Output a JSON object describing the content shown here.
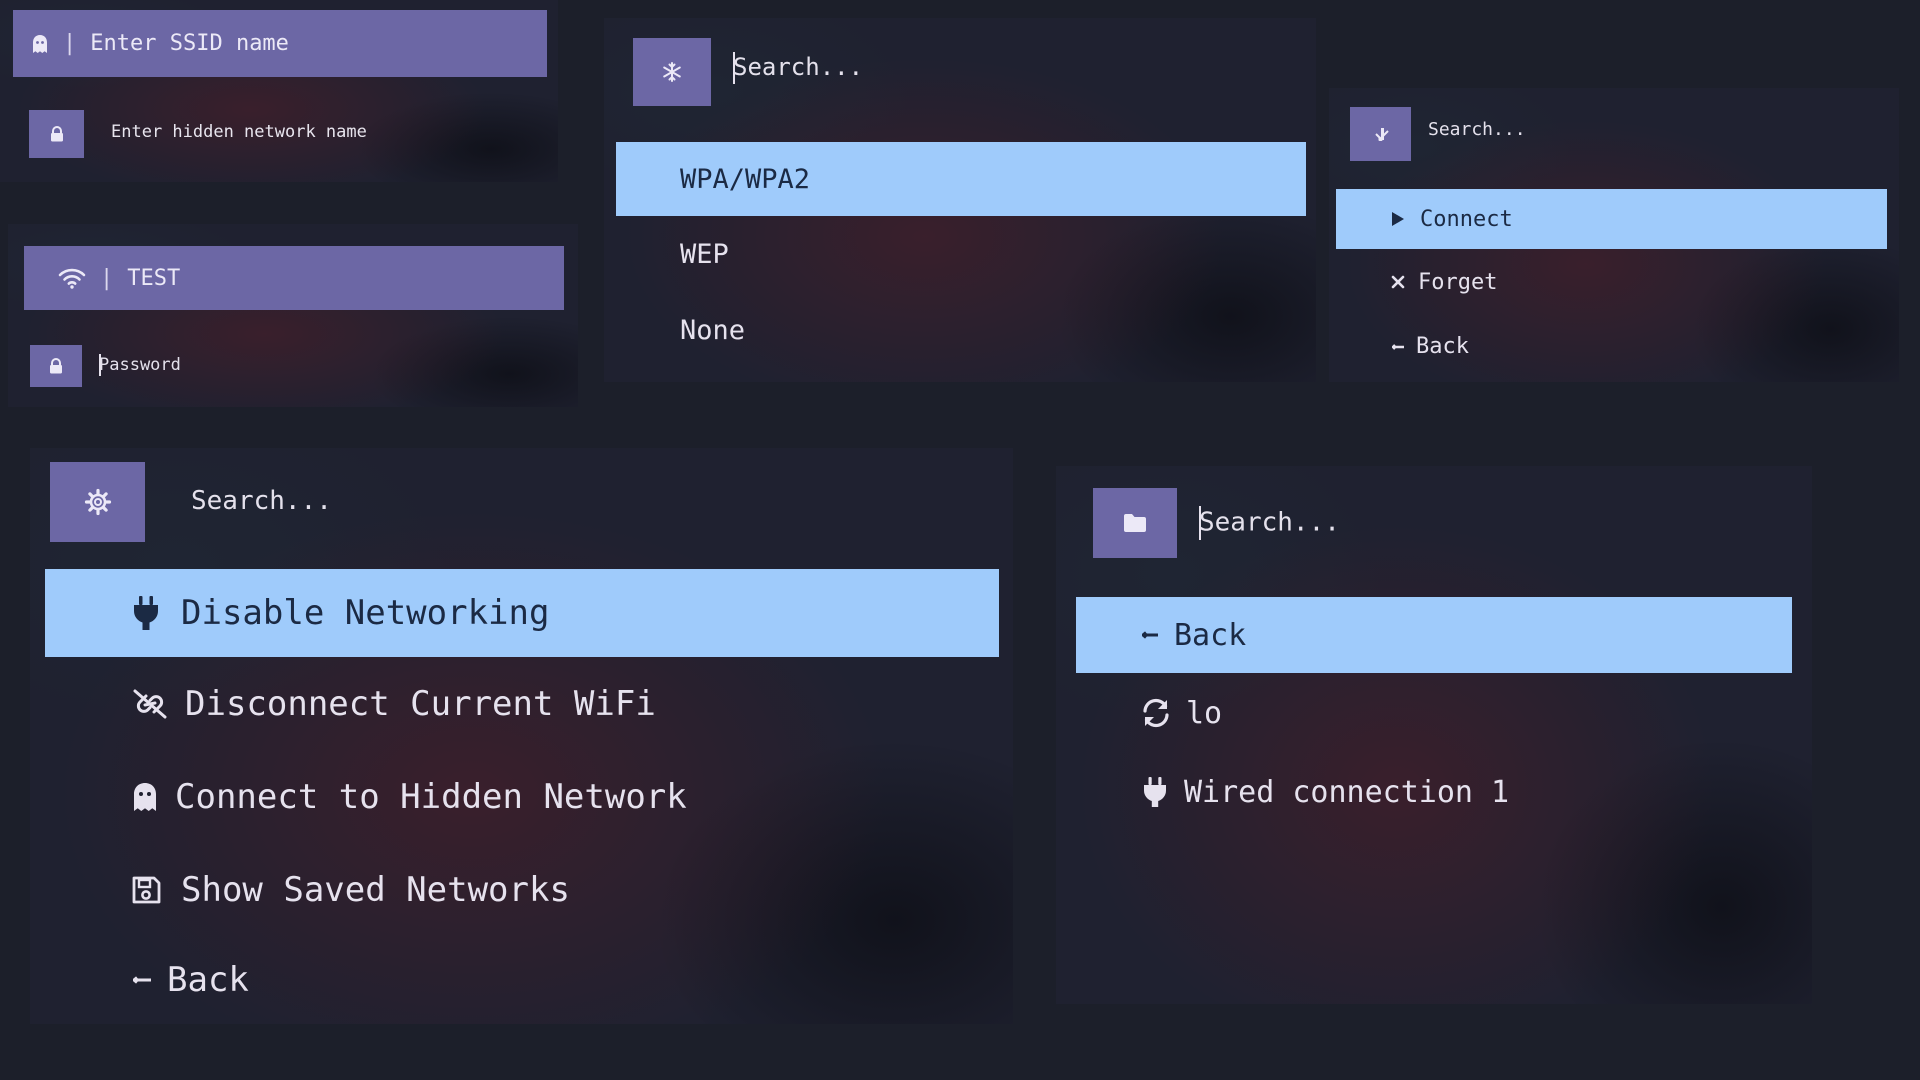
{
  "colors": {
    "accent": "#6c67a5",
    "selected": "#9fcbfb",
    "selected_text": "#1b2a44",
    "text": "#e6e2ee",
    "background": "#1c1f2a"
  },
  "ssid_prompt": {
    "header_icon": "ghost-icon",
    "header_text": "Enter SSID name",
    "input_icon": "lock-icon",
    "input_placeholder": "Enter hidden network name"
  },
  "password_prompt": {
    "header_icon": "wifi-icon",
    "header_text": "TEST",
    "input_icon": "lock-icon",
    "input_placeholder": "Password"
  },
  "security_menu": {
    "search_icon": "snowflake-icon",
    "search_placeholder": "Search...",
    "items": [
      {
        "label": "WPA/WPA2",
        "selected": true
      },
      {
        "label": "WEP",
        "selected": false
      },
      {
        "label": "None",
        "selected": false
      }
    ]
  },
  "network_actions_menu": {
    "search_icon": "signal-icon",
    "search_placeholder": "Search...",
    "items": [
      {
        "icon": "play-icon",
        "label": "Connect",
        "selected": true
      },
      {
        "icon": "close-icon",
        "label": "Forget",
        "selected": false
      },
      {
        "icon": "back-arrow-icon",
        "label": "Back",
        "selected": false
      }
    ]
  },
  "main_menu": {
    "search_icon": "gear-icon",
    "search_placeholder": "Search...",
    "items": [
      {
        "icon": "plug-icon",
        "label": "Disable Networking",
        "selected": true
      },
      {
        "icon": "broken-link-icon",
        "label": "Disconnect Current WiFi",
        "selected": false
      },
      {
        "icon": "ghost-icon",
        "label": "Connect to Hidden Network",
        "selected": false
      },
      {
        "icon": "save-icon",
        "label": "Show Saved Networks",
        "selected": false
      },
      {
        "icon": "back-arrow-icon",
        "label": "Back",
        "selected": false
      }
    ]
  },
  "connections_menu": {
    "search_icon": "folder-icon",
    "search_placeholder": "Search...",
    "items": [
      {
        "icon": "back-arrow-icon",
        "label": "Back",
        "selected": true
      },
      {
        "icon": "refresh-icon",
        "label": "lo",
        "selected": false
      },
      {
        "icon": "plug-icon",
        "label": "Wired connection 1",
        "selected": false
      }
    ]
  }
}
